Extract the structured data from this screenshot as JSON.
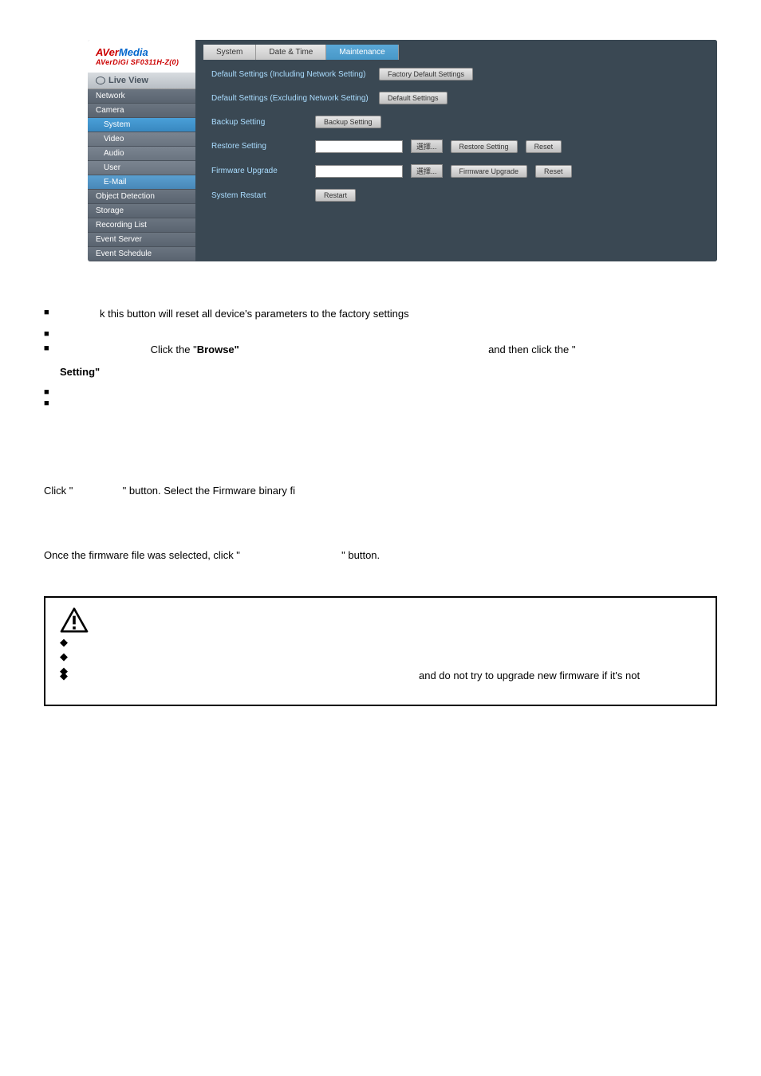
{
  "screenshot": {
    "logo": {
      "part1": "AVer",
      "part2": "Media",
      "sub": "AVerDiGi SF0311H-Z(0)"
    },
    "liveView": "Live View",
    "nav": {
      "network": "Network",
      "camera": "Camera",
      "system": "System",
      "video": "Video",
      "audio": "Audio",
      "user": "User",
      "email": "E-Mail",
      "objectDetection": "Object Detection",
      "storage": "Storage",
      "recordingList": "Recording List",
      "eventServer": "Event Server",
      "eventSchedule": "Event Schedule"
    },
    "tabs": {
      "system": "System",
      "dateTime": "Date & Time",
      "maintenance": "Maintenance"
    },
    "rows": {
      "defIncl": "Default Settings (Including Network Setting)",
      "defInclBtn": "Factory Default Settings",
      "defExcl": "Default Settings (Excluding Network Setting)",
      "defExclBtn": "Default Settings",
      "backup": "Backup Setting",
      "backupBtn": "Backup Setting",
      "restore": "Restore Setting",
      "restoreBrowse": "選擇...",
      "restoreBtn": "Restore Setting",
      "restoreReset": "Reset",
      "firmware": "Firmware Upgrade",
      "firmwareBrowse": "選擇...",
      "firmwareBtn": "Firmware Upgrade",
      "firmwareReset": "Reset",
      "restart": "System Restart",
      "restartBtn": "Restart"
    }
  },
  "doc": {
    "line1": "k this button will reset all device's parameters to the factory settings",
    "browseLabel": "Click the \"",
    "browseBold": "Browse\"",
    "thenClick": "and then click the \"",
    "settingBold": "Setting\"",
    "clickBrowseLine": "Click \"",
    "clickBrowseMid": "\" button. Select the Firmware binary fi",
    "onceFirmware": "Once the firmware file was selected, click \"",
    "onceFirmwareEnd": "\" button.",
    "warning": {
      "pointRight": "and do not try to upgrade new firmware if it's not"
    }
  }
}
